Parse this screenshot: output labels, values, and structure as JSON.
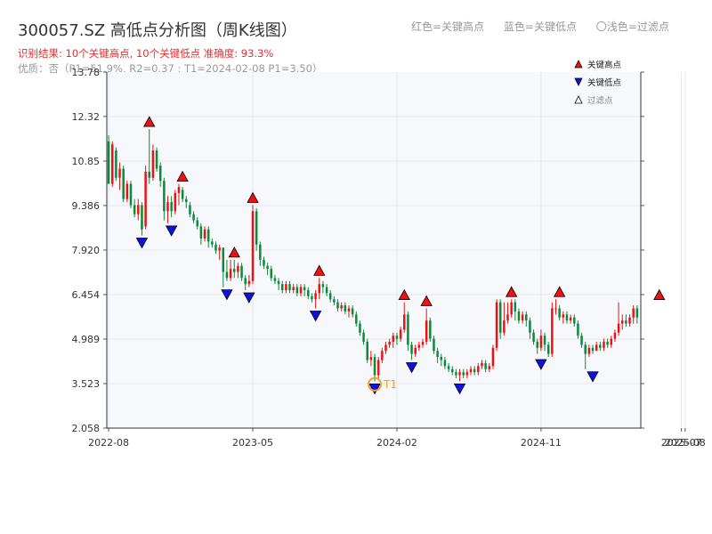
{
  "header": {
    "title": "300057.SZ 高低点分析图（周K线图）",
    "result_text": "识别结果: 10个关键高点, 10个关键低点  准确度: 93.3%",
    "stats_text": "优质：否（P1=51.9%, R2=0.37 ; T1=2024-02-08 P1=3.50）"
  },
  "top_legend": [
    "红色=关键高点",
    "蓝色=关键低点",
    "〇浅色=过滤点"
  ],
  "chart_data": {
    "type": "candlestick",
    "title": "300057.SZ 高低点分析图（周K线图）",
    "y_ticks": [
      "2.058",
      "3.523",
      "4.989",
      "6.454",
      "7.920",
      "9.386",
      "10.85",
      "12.32",
      "13.78"
    ],
    "ylim": [
      2.058,
      13.78
    ],
    "x_ticks": [
      "2022-08",
      "2023-05",
      "2024-02",
      "2024-11",
      "2025-08",
      "2025-07"
    ],
    "x_tick_weeks": [
      0,
      39,
      78,
      117,
      156,
      155
    ],
    "grid": true,
    "legend_position": "top-right",
    "legend": [
      {
        "label": "关键高点",
        "marker": "triangle-up",
        "color": "#ee1111"
      },
      {
        "label": "关键低点",
        "marker": "triangle-down",
        "color": "#1111dd"
      },
      {
        "label": "过滤点",
        "marker": "triangle-up-outline",
        "color": "#000000"
      }
    ],
    "colors": {
      "up": "#ee1111",
      "down": "#0a8a3a",
      "high": "#ee1111",
      "low": "#1111dd",
      "t1_ring": "#f5a020",
      "t1_label": "#f5a020"
    },
    "candles": [
      [
        11.5,
        10.1,
        11.7,
        10.1
      ],
      [
        10.1,
        11.4,
        11.5,
        10.0
      ],
      [
        11.2,
        10.3,
        11.3,
        10.2
      ],
      [
        10.3,
        10.6,
        10.8,
        9.9
      ],
      [
        10.6,
        9.6,
        10.7,
        9.5
      ],
      [
        9.6,
        10.1,
        10.2,
        9.5
      ],
      [
        10.1,
        9.4,
        10.2,
        9.3
      ],
      [
        9.4,
        9.1,
        9.6,
        9.0
      ],
      [
        9.1,
        9.4,
        9.6,
        8.9
      ],
      [
        9.4,
        8.6,
        9.5,
        8.4
      ],
      [
        8.7,
        10.5,
        10.7,
        8.6
      ],
      [
        10.5,
        10.3,
        11.9,
        10.1
      ],
      [
        10.3,
        11.2,
        11.4,
        10.2
      ],
      [
        11.2,
        10.6,
        11.3,
        10.5
      ],
      [
        10.7,
        10.2,
        10.8,
        10.0
      ],
      [
        10.2,
        9.2,
        10.3,
        8.9
      ],
      [
        9.2,
        9.5,
        9.7,
        8.8
      ],
      [
        9.5,
        9.2,
        9.7,
        9.0
      ],
      [
        9.2,
        9.8,
        9.9,
        9.1
      ],
      [
        9.8,
        10.0,
        10.1,
        9.4
      ],
      [
        9.9,
        9.6,
        10.0,
        9.5
      ],
      [
        9.6,
        9.5,
        9.7,
        9.3
      ],
      [
        9.4,
        9.1,
        9.5,
        9.0
      ],
      [
        9.1,
        8.9,
        9.2,
        8.8
      ],
      [
        8.9,
        8.7,
        9.0,
        8.6
      ],
      [
        8.7,
        8.3,
        8.8,
        8.1
      ],
      [
        8.3,
        8.6,
        8.7,
        8.2
      ],
      [
        8.6,
        8.2,
        8.7,
        8.0
      ],
      [
        8.2,
        8.1,
        8.3,
        8.0
      ],
      [
        8.1,
        7.9,
        8.2,
        7.8
      ],
      [
        7.9,
        8.0,
        8.1,
        7.6
      ],
      [
        8.0,
        7.2,
        8.0,
        6.7
      ],
      [
        7.2,
        7.0,
        7.6,
        6.9
      ],
      [
        7.0,
        7.3,
        7.6,
        6.9
      ],
      [
        7.3,
        7.2,
        7.6,
        7.0
      ],
      [
        7.2,
        7.4,
        7.5,
        7.0
      ],
      [
        7.4,
        7.0,
        7.5,
        6.9
      ],
      [
        7.0,
        6.8,
        7.1,
        6.6
      ],
      [
        6.8,
        6.9,
        7.1,
        6.7
      ],
      [
        6.9,
        9.2,
        9.4,
        6.8
      ],
      [
        9.2,
        8.1,
        9.3,
        7.9
      ],
      [
        8.1,
        7.6,
        8.2,
        7.4
      ],
      [
        7.6,
        7.4,
        7.7,
        7.3
      ],
      [
        7.4,
        7.3,
        7.5,
        7.1
      ],
      [
        7.3,
        7.0,
        7.4,
        6.9
      ],
      [
        7.0,
        6.9,
        7.1,
        6.8
      ],
      [
        6.9,
        6.8,
        7.0,
        6.6
      ],
      [
        6.8,
        6.6,
        6.9,
        6.5
      ],
      [
        6.6,
        6.8,
        6.9,
        6.5
      ],
      [
        6.8,
        6.6,
        6.9,
        6.5
      ],
      [
        6.6,
        6.7,
        6.8,
        6.5
      ],
      [
        6.7,
        6.5,
        6.8,
        6.4
      ],
      [
        6.5,
        6.7,
        6.8,
        6.4
      ],
      [
        6.7,
        6.6,
        6.8,
        6.4
      ],
      [
        6.6,
        6.4,
        6.7,
        6.3
      ],
      [
        6.4,
        6.3,
        6.5,
        6.2
      ],
      [
        6.3,
        6.5,
        6.6,
        6.0
      ],
      [
        6.5,
        6.8,
        7.0,
        6.3
      ],
      [
        6.8,
        6.7,
        6.9,
        6.5
      ],
      [
        6.7,
        6.5,
        6.8,
        6.4
      ],
      [
        6.5,
        6.3,
        6.6,
        6.2
      ],
      [
        6.3,
        6.2,
        6.4,
        6.1
      ],
      [
        6.2,
        6.0,
        6.3,
        5.9
      ],
      [
        6.0,
        6.1,
        6.2,
        5.9
      ],
      [
        6.1,
        5.9,
        6.2,
        5.8
      ],
      [
        5.9,
        6.0,
        6.1,
        5.7
      ],
      [
        6.0,
        5.8,
        6.1,
        5.7
      ],
      [
        5.8,
        5.5,
        5.9,
        5.4
      ],
      [
        5.5,
        5.2,
        5.6,
        5.1
      ],
      [
        5.2,
        4.9,
        5.3,
        4.8
      ],
      [
        4.9,
        4.3,
        5.0,
        4.2
      ],
      [
        4.3,
        4.4,
        4.6,
        4.1
      ],
      [
        4.4,
        3.8,
        4.5,
        3.6
      ],
      [
        3.8,
        4.3,
        4.4,
        3.7
      ],
      [
        4.3,
        4.6,
        4.7,
        4.2
      ],
      [
        4.6,
        4.8,
        4.9,
        4.5
      ],
      [
        4.8,
        4.9,
        5.0,
        4.7
      ],
      [
        4.9,
        5.1,
        5.2,
        4.7
      ],
      [
        5.1,
        5.0,
        5.2,
        4.8
      ],
      [
        5.0,
        5.3,
        5.4,
        4.9
      ],
      [
        5.3,
        5.8,
        6.2,
        5.2
      ],
      [
        5.8,
        4.8,
        5.9,
        4.6
      ],
      [
        4.8,
        4.5,
        4.9,
        4.3
      ],
      [
        4.5,
        4.7,
        4.8,
        4.4
      ],
      [
        4.7,
        4.8,
        4.9,
        4.6
      ],
      [
        4.8,
        4.9,
        5.0,
        4.7
      ],
      [
        4.9,
        5.6,
        6.0,
        4.8
      ],
      [
        5.6,
        5.0,
        5.7,
        4.9
      ],
      [
        5.0,
        4.6,
        5.1,
        4.5
      ],
      [
        4.6,
        4.4,
        4.7,
        4.2
      ],
      [
        4.4,
        4.3,
        4.5,
        4.1
      ],
      [
        4.3,
        4.1,
        4.4,
        4.0
      ],
      [
        4.1,
        4.0,
        4.2,
        3.9
      ],
      [
        4.0,
        3.9,
        4.1,
        3.8
      ],
      [
        3.9,
        3.8,
        4.0,
        3.7
      ],
      [
        3.8,
        3.9,
        4.0,
        3.6
      ],
      [
        3.9,
        3.8,
        4.0,
        3.7
      ],
      [
        3.8,
        3.9,
        4.0,
        3.7
      ],
      [
        3.9,
        4.0,
        4.1,
        3.8
      ],
      [
        4.0,
        3.9,
        4.1,
        3.8
      ],
      [
        3.9,
        4.1,
        4.2,
        3.8
      ],
      [
        4.1,
        4.2,
        4.3,
        4.0
      ],
      [
        4.2,
        4.0,
        4.3,
        3.9
      ],
      [
        4.0,
        4.1,
        4.2,
        3.9
      ],
      [
        4.1,
        4.7,
        4.8,
        4.0
      ],
      [
        4.7,
        6.2,
        6.3,
        4.6
      ],
      [
        6.2,
        5.2,
        6.3,
        5.0
      ],
      [
        5.2,
        5.6,
        6.2,
        5.1
      ],
      [
        5.6,
        5.8,
        6.2,
        5.5
      ],
      [
        5.8,
        6.2,
        6.3,
        5.7
      ],
      [
        6.2,
        5.9,
        6.3,
        5.6
      ],
      [
        5.9,
        5.6,
        6.0,
        5.5
      ],
      [
        5.6,
        5.8,
        5.9,
        5.5
      ],
      [
        5.8,
        5.6,
        5.9,
        5.4
      ],
      [
        5.6,
        5.2,
        5.7,
        5.0
      ],
      [
        5.2,
        4.9,
        5.3,
        4.8
      ],
      [
        4.9,
        4.7,
        5.0,
        4.5
      ],
      [
        4.7,
        5.1,
        5.3,
        4.6
      ],
      [
        5.1,
        4.8,
        5.2,
        4.6
      ],
      [
        4.8,
        4.5,
        4.9,
        4.4
      ],
      [
        4.5,
        6.0,
        6.2,
        4.4
      ],
      [
        6.0,
        6.0,
        6.3,
        5.8
      ],
      [
        6.0,
        5.7,
        6.1,
        5.6
      ],
      [
        5.7,
        5.8,
        5.9,
        5.5
      ],
      [
        5.8,
        5.6,
        5.9,
        5.5
      ],
      [
        5.6,
        5.7,
        5.8,
        5.5
      ],
      [
        5.7,
        5.5,
        5.8,
        5.4
      ],
      [
        5.5,
        5.1,
        5.6,
        5.0
      ],
      [
        5.1,
        4.8,
        5.2,
        4.7
      ],
      [
        4.8,
        4.5,
        4.9,
        4.0
      ],
      [
        4.5,
        4.7,
        4.8,
        4.4
      ],
      [
        4.7,
        4.6,
        4.8,
        4.5
      ],
      [
        4.6,
        4.8,
        4.9,
        4.6
      ],
      [
        4.8,
        4.7,
        4.9,
        4.6
      ],
      [
        4.7,
        4.9,
        5.0,
        4.6
      ],
      [
        4.9,
        4.8,
        5.0,
        4.7
      ],
      [
        4.8,
        5.0,
        5.1,
        4.7
      ],
      [
        5.0,
        5.2,
        5.3,
        4.9
      ],
      [
        5.2,
        5.5,
        6.2,
        5.1
      ],
      [
        5.5,
        5.6,
        5.8,
        5.3
      ],
      [
        5.6,
        5.5,
        5.8,
        5.4
      ],
      [
        5.5,
        5.7,
        5.8,
        5.4
      ],
      [
        5.7,
        6.0,
        6.1,
        5.5
      ],
      [
        6.0,
        5.7,
        6.1,
        5.5
      ]
    ],
    "key_highs": [
      {
        "week": 11,
        "price": 11.9
      },
      {
        "week": 20,
        "price": 10.1
      },
      {
        "week": 34,
        "price": 7.6
      },
      {
        "week": 39,
        "price": 9.4
      },
      {
        "week": 57,
        "price": 7.0
      },
      {
        "week": 80,
        "price": 6.2
      },
      {
        "week": 86,
        "price": 6.0
      },
      {
        "week": 109,
        "price": 6.3
      },
      {
        "week": 122,
        "price": 6.3
      },
      {
        "week": 149,
        "price": 6.2
      }
    ],
    "key_lows": [
      {
        "week": 9,
        "price": 8.4
      },
      {
        "week": 17,
        "price": 8.8
      },
      {
        "week": 32,
        "price": 6.7
      },
      {
        "week": 38,
        "price": 6.6
      },
      {
        "week": 56,
        "price": 6.0
      },
      {
        "week": 72,
        "price": 3.6
      },
      {
        "week": 82,
        "price": 4.3
      },
      {
        "week": 95,
        "price": 3.6
      },
      {
        "week": 117,
        "price": 4.4
      },
      {
        "week": 131,
        "price": 4.0
      }
    ],
    "t1": {
      "week": 72,
      "price": 3.5,
      "label": "T1"
    }
  }
}
